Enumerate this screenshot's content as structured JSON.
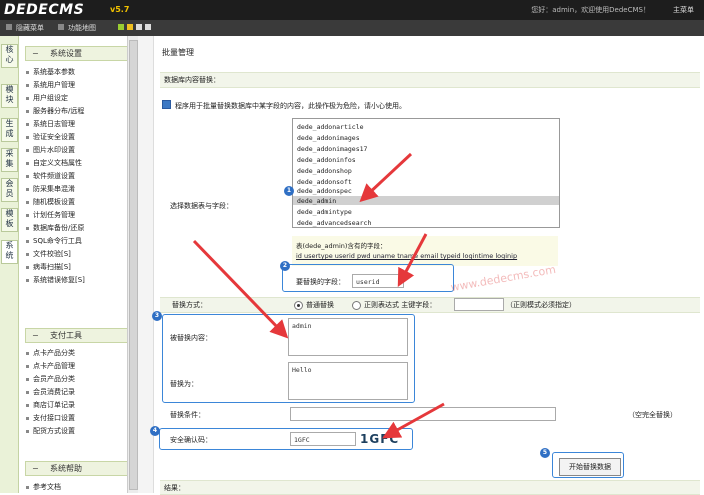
{
  "header": {
    "logo": "DEDECMS",
    "version": "v5.7",
    "user_info": "您好：admin，欢迎使用DedeCMS！",
    "main_link": "主菜单"
  },
  "subbar": {
    "hide_menu": "隐藏菜单",
    "feature_map": "功能地图"
  },
  "vtabs": [
    "核心",
    "模块",
    "生成",
    "采集",
    "会员",
    "模板",
    "系统"
  ],
  "sidebar": {
    "sections": [
      {
        "title": "系统设置",
        "toggle": "−",
        "items": [
          "系统基本参数",
          "系统用户管理",
          "用户组设定",
          "服务器分布/远程",
          "系统日志管理",
          "验证安全设置",
          "图片水印设置",
          "自定义文档属性",
          "软件频道设置",
          "防采集串混淆",
          "随机模板设置",
          "计划任务管理",
          "数据库备份/还原",
          "SQL命令行工具",
          "文件校验[S]",
          "病毒扫描[S]",
          "系统错误修复[S]"
        ]
      },
      {
        "title": "支付工具",
        "toggle": "−",
        "items": [
          "点卡产品分类",
          "点卡产品管理",
          "会员产品分类",
          "会员消费记录",
          "商店订单记录",
          "支付接口设置",
          "配货方式设置"
        ]
      },
      {
        "title": "系统帮助",
        "toggle": "−",
        "items": [
          "参考文档"
        ]
      }
    ]
  },
  "main": {
    "page_title": "批量管理",
    "section_title": "数据库内容替换：",
    "notice": "程序用于批量替换数据库中某字段的内容，此操作极为危险，请小心使用。",
    "table_label": "选择数据表与字段：",
    "tables": [
      "dede_addonarticle",
      "dede_addonimages",
      "dede_addonimages17",
      "dede_addoninfos",
      "dede_addonshop",
      "dede_addonsoft",
      "dede_addonspec",
      "dede_admin",
      "dede_admintype",
      "dede_advancedsearch"
    ],
    "selected_table": "dede_admin",
    "fields_caption": "表(dede_admin)含有的字段：",
    "fields": "id usertype userid pwd uname tname email typeid logintime loginip",
    "replace_field_label": "要替换的字段：",
    "replace_field_value": "userid",
    "method_label": "替换方式：",
    "method_normal": "普通替换",
    "method_regex": "正则表达式 主键字段：",
    "method_regex_note": "（正则模式必须指定）",
    "replaced_label": "被替换内容：",
    "replaced_value": "admin",
    "replace_with_label": "替换为：",
    "replace_with_value": "Hello",
    "condition_label": "替换条件：",
    "condition_note": "（空完全替换）",
    "captcha_label": "安全确认码：",
    "captcha_input": "1GFC",
    "captcha_image_text": "1GFC",
    "submit_label": "开始替换数据",
    "result_label": "结果：",
    "badges": [
      "1",
      "2",
      "3",
      "4",
      "5"
    ],
    "watermark": "www.dedecms.com"
  }
}
